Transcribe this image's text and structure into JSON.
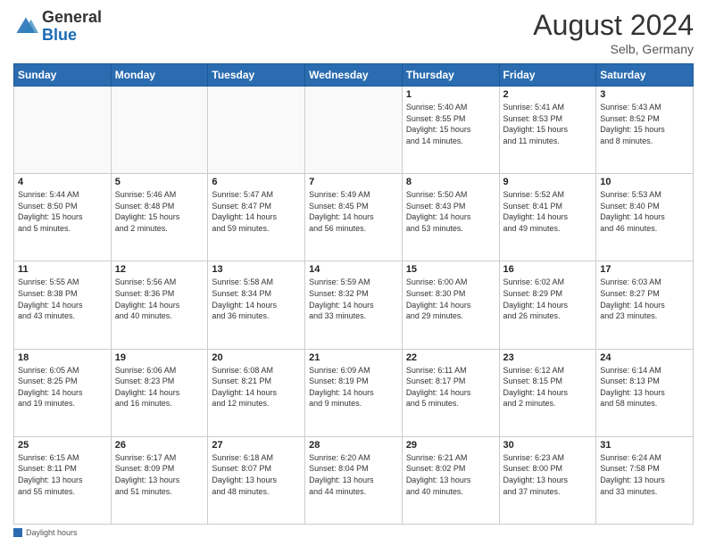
{
  "header": {
    "logo_general": "General",
    "logo_blue": "Blue",
    "month_title": "August 2024",
    "location": "Selb, Germany"
  },
  "footer": {
    "label": "Daylight hours"
  },
  "days_of_week": [
    "Sunday",
    "Monday",
    "Tuesday",
    "Wednesday",
    "Thursday",
    "Friday",
    "Saturday"
  ],
  "weeks": [
    [
      {
        "day": "",
        "info": ""
      },
      {
        "day": "",
        "info": ""
      },
      {
        "day": "",
        "info": ""
      },
      {
        "day": "",
        "info": ""
      },
      {
        "day": "1",
        "info": "Sunrise: 5:40 AM\nSunset: 8:55 PM\nDaylight: 15 hours\nand 14 minutes."
      },
      {
        "day": "2",
        "info": "Sunrise: 5:41 AM\nSunset: 8:53 PM\nDaylight: 15 hours\nand 11 minutes."
      },
      {
        "day": "3",
        "info": "Sunrise: 5:43 AM\nSunset: 8:52 PM\nDaylight: 15 hours\nand 8 minutes."
      }
    ],
    [
      {
        "day": "4",
        "info": "Sunrise: 5:44 AM\nSunset: 8:50 PM\nDaylight: 15 hours\nand 5 minutes."
      },
      {
        "day": "5",
        "info": "Sunrise: 5:46 AM\nSunset: 8:48 PM\nDaylight: 15 hours\nand 2 minutes."
      },
      {
        "day": "6",
        "info": "Sunrise: 5:47 AM\nSunset: 8:47 PM\nDaylight: 14 hours\nand 59 minutes."
      },
      {
        "day": "7",
        "info": "Sunrise: 5:49 AM\nSunset: 8:45 PM\nDaylight: 14 hours\nand 56 minutes."
      },
      {
        "day": "8",
        "info": "Sunrise: 5:50 AM\nSunset: 8:43 PM\nDaylight: 14 hours\nand 53 minutes."
      },
      {
        "day": "9",
        "info": "Sunrise: 5:52 AM\nSunset: 8:41 PM\nDaylight: 14 hours\nand 49 minutes."
      },
      {
        "day": "10",
        "info": "Sunrise: 5:53 AM\nSunset: 8:40 PM\nDaylight: 14 hours\nand 46 minutes."
      }
    ],
    [
      {
        "day": "11",
        "info": "Sunrise: 5:55 AM\nSunset: 8:38 PM\nDaylight: 14 hours\nand 43 minutes."
      },
      {
        "day": "12",
        "info": "Sunrise: 5:56 AM\nSunset: 8:36 PM\nDaylight: 14 hours\nand 40 minutes."
      },
      {
        "day": "13",
        "info": "Sunrise: 5:58 AM\nSunset: 8:34 PM\nDaylight: 14 hours\nand 36 minutes."
      },
      {
        "day": "14",
        "info": "Sunrise: 5:59 AM\nSunset: 8:32 PM\nDaylight: 14 hours\nand 33 minutes."
      },
      {
        "day": "15",
        "info": "Sunrise: 6:00 AM\nSunset: 8:30 PM\nDaylight: 14 hours\nand 29 minutes."
      },
      {
        "day": "16",
        "info": "Sunrise: 6:02 AM\nSunset: 8:29 PM\nDaylight: 14 hours\nand 26 minutes."
      },
      {
        "day": "17",
        "info": "Sunrise: 6:03 AM\nSunset: 8:27 PM\nDaylight: 14 hours\nand 23 minutes."
      }
    ],
    [
      {
        "day": "18",
        "info": "Sunrise: 6:05 AM\nSunset: 8:25 PM\nDaylight: 14 hours\nand 19 minutes."
      },
      {
        "day": "19",
        "info": "Sunrise: 6:06 AM\nSunset: 8:23 PM\nDaylight: 14 hours\nand 16 minutes."
      },
      {
        "day": "20",
        "info": "Sunrise: 6:08 AM\nSunset: 8:21 PM\nDaylight: 14 hours\nand 12 minutes."
      },
      {
        "day": "21",
        "info": "Sunrise: 6:09 AM\nSunset: 8:19 PM\nDaylight: 14 hours\nand 9 minutes."
      },
      {
        "day": "22",
        "info": "Sunrise: 6:11 AM\nSunset: 8:17 PM\nDaylight: 14 hours\nand 5 minutes."
      },
      {
        "day": "23",
        "info": "Sunrise: 6:12 AM\nSunset: 8:15 PM\nDaylight: 14 hours\nand 2 minutes."
      },
      {
        "day": "24",
        "info": "Sunrise: 6:14 AM\nSunset: 8:13 PM\nDaylight: 13 hours\nand 58 minutes."
      }
    ],
    [
      {
        "day": "25",
        "info": "Sunrise: 6:15 AM\nSunset: 8:11 PM\nDaylight: 13 hours\nand 55 minutes."
      },
      {
        "day": "26",
        "info": "Sunrise: 6:17 AM\nSunset: 8:09 PM\nDaylight: 13 hours\nand 51 minutes."
      },
      {
        "day": "27",
        "info": "Sunrise: 6:18 AM\nSunset: 8:07 PM\nDaylight: 13 hours\nand 48 minutes."
      },
      {
        "day": "28",
        "info": "Sunrise: 6:20 AM\nSunset: 8:04 PM\nDaylight: 13 hours\nand 44 minutes."
      },
      {
        "day": "29",
        "info": "Sunrise: 6:21 AM\nSunset: 8:02 PM\nDaylight: 13 hours\nand 40 minutes."
      },
      {
        "day": "30",
        "info": "Sunrise: 6:23 AM\nSunset: 8:00 PM\nDaylight: 13 hours\nand 37 minutes."
      },
      {
        "day": "31",
        "info": "Sunrise: 6:24 AM\nSunset: 7:58 PM\nDaylight: 13 hours\nand 33 minutes."
      }
    ]
  ]
}
